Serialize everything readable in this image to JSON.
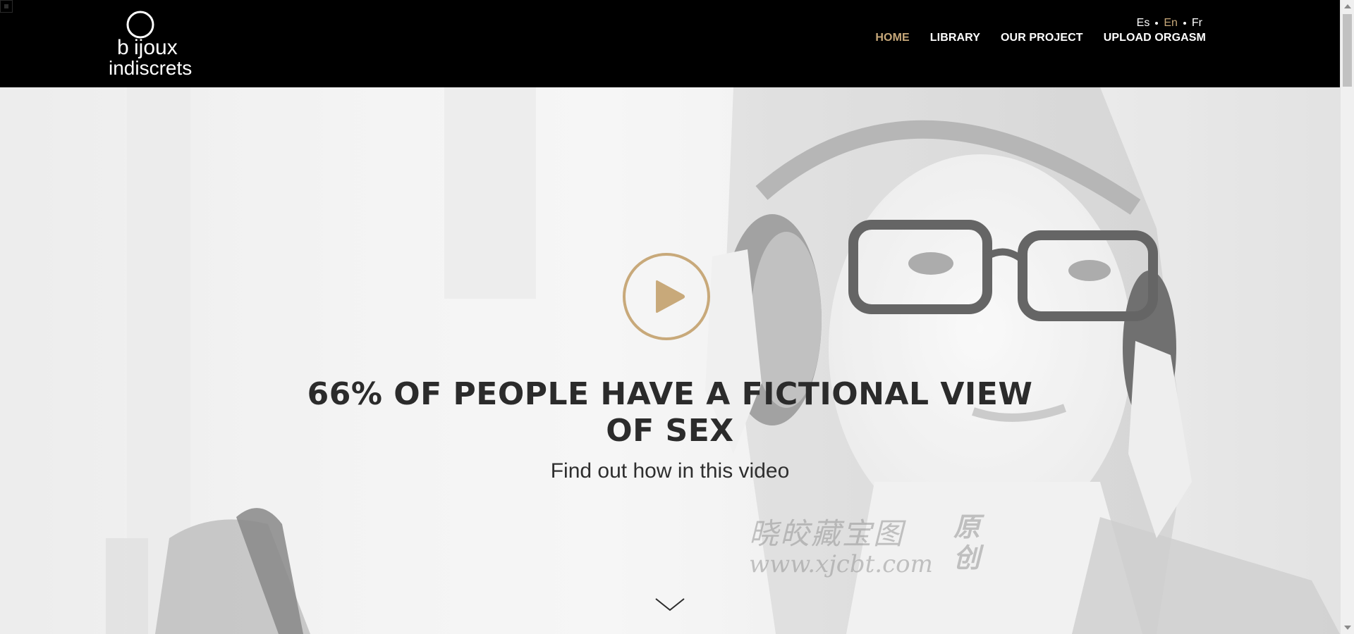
{
  "header": {
    "logo_text": "bijoux indiscrets",
    "languages": [
      {
        "label": "Es",
        "active": false
      },
      {
        "label": "En",
        "active": true
      },
      {
        "label": "Fr",
        "active": false
      }
    ],
    "nav": [
      {
        "label": "HOME",
        "active": true
      },
      {
        "label": "LIBRARY",
        "active": false
      },
      {
        "label": "OUR PROJECT",
        "active": false
      },
      {
        "label": "UPLOAD ORGASM",
        "active": false
      }
    ]
  },
  "hero": {
    "headline": "66% OF PEOPLE HAVE A FICTIONAL VIEW OF SEX",
    "subline": "Find out how in this video",
    "play_icon": "play-icon",
    "scroll_icon": "chevron-down-icon"
  },
  "watermark": {
    "line1": "晓皎藏宝图",
    "line2": "www.xjcbt.com",
    "side": "原 创"
  },
  "colors": {
    "accent": "#c8a97a",
    "header_bg": "#000000",
    "text_dark": "#2b2b2b"
  }
}
